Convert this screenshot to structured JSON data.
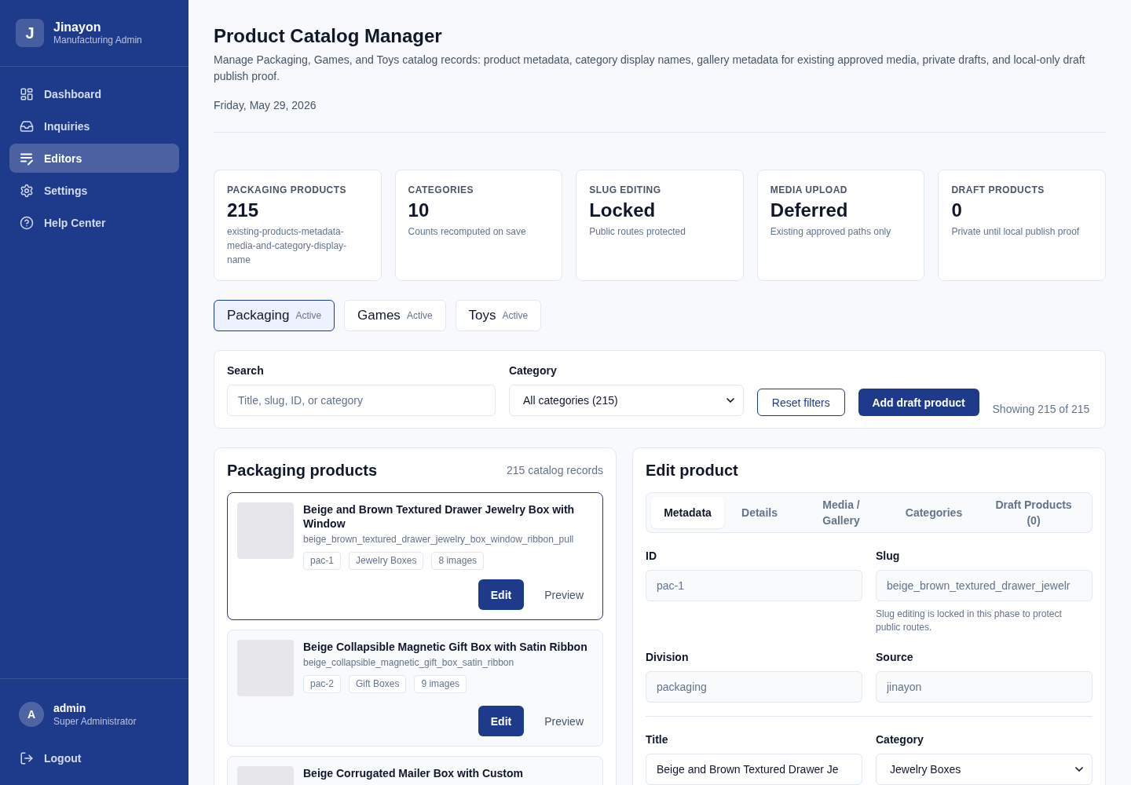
{
  "sidebar": {
    "brand": {
      "initial": "J",
      "name": "Jinayon",
      "subtitle": "Manufacturing Admin"
    },
    "nav": [
      {
        "label": "Dashboard",
        "selected": false
      },
      {
        "label": "Inquiries",
        "selected": false
      },
      {
        "label": "Editors",
        "selected": true
      },
      {
        "label": "Settings",
        "selected": false
      },
      {
        "label": "Help Center",
        "selected": false
      }
    ],
    "user": {
      "initial": "A",
      "name": "admin",
      "role": "Super Administrator"
    },
    "logout": "Logout"
  },
  "header": {
    "title": "Product Catalog Manager",
    "description": "Manage Packaging, Games, and Toys catalog records: product metadata, category display names, gallery metadata for existing approved media, private drafts, and local-only draft publish proof.",
    "date": "Friday, May 29, 2026"
  },
  "stats": [
    {
      "label": "PACKAGING PRODUCTS",
      "value": "215",
      "note": "existing-products-metadata-media-and-category-display-name"
    },
    {
      "label": "CATEGORIES",
      "value": "10",
      "note": "Counts recomputed on save"
    },
    {
      "label": "SLUG EDITING",
      "value": "Locked",
      "note": "Public routes protected"
    },
    {
      "label": "MEDIA UPLOAD",
      "value": "Deferred",
      "note": "Existing approved paths only"
    },
    {
      "label": "DRAFT PRODUCTS",
      "value": "0",
      "note": "Private until local publish proof"
    }
  ],
  "division_tabs": [
    {
      "label": "Packaging",
      "status": "Active",
      "selected": true
    },
    {
      "label": "Games",
      "status": "Active",
      "selected": false
    },
    {
      "label": "Toys",
      "status": "Active",
      "selected": false
    }
  ],
  "filters": {
    "search": {
      "label": "Search",
      "placeholder": "Title, slug, ID, or category"
    },
    "category": {
      "label": "Category",
      "value": "All categories (215)"
    },
    "reset": "Reset filters",
    "add": "Add draft product",
    "showing": "Showing 215 of 215"
  },
  "product_list": {
    "title": "Packaging products",
    "count": "215 catalog records",
    "products": [
      {
        "title": "Beige and Brown Textured Drawer Jewelry Box with Window",
        "slug": "beige_brown_textured_drawer_jewelry_box_window_ribbon_pull",
        "tags": [
          "pac-1",
          "Jewelry Boxes",
          "8 images"
        ],
        "actions": [
          {
            "label": "Edit",
            "kind": "primary"
          },
          {
            "label": "Preview",
            "kind": "ghost"
          }
        ],
        "selected": true
      },
      {
        "title": "Beige Collapsible Magnetic Gift Box with Satin Ribbon",
        "slug": "beige_collapsible_magnetic_gift_box_satin_ribbon",
        "tags": [
          "pac-2",
          "Gift Boxes",
          "9 images"
        ],
        "actions": [
          {
            "label": "Edit",
            "kind": "primary"
          },
          {
            "label": "Preview",
            "kind": "ghost"
          }
        ],
        "selected": false
      },
      {
        "title": "Beige Corrugated Mailer Box with Custom",
        "selected": false
      }
    ]
  },
  "editor": {
    "title": "Edit product",
    "tabs": [
      {
        "label": "Metadata",
        "selected": true
      },
      {
        "label": "Details",
        "selected": false
      },
      {
        "label": "Media / Gallery",
        "selected": false
      },
      {
        "label": "Categories",
        "selected": false
      },
      {
        "label": "Draft Products (0)",
        "selected": false
      }
    ],
    "groups": [
      {
        "fields": [
          {
            "label": "ID",
            "kind": "input",
            "value": "pac-1",
            "disabled": true
          },
          {
            "label": "Slug",
            "kind": "input",
            "value": "beige_brown_textured_drawer_jewelr",
            "disabled": true,
            "hint": "Slug editing is locked in this phase to protect public routes."
          },
          {
            "label": "Division",
            "kind": "input",
            "value": "packaging",
            "disabled": true
          },
          {
            "label": "Source",
            "kind": "input",
            "value": "jinayon",
            "disabled": true
          }
        ]
      },
      {
        "fields": [
          {
            "label": "Title",
            "kind": "input",
            "value": "Beige and Brown Textured Drawer Je",
            "disabled": false
          },
          {
            "label": "Category",
            "kind": "select",
            "value": "Jewelry Boxes",
            "disabled": false
          }
        ]
      }
    ]
  }
}
